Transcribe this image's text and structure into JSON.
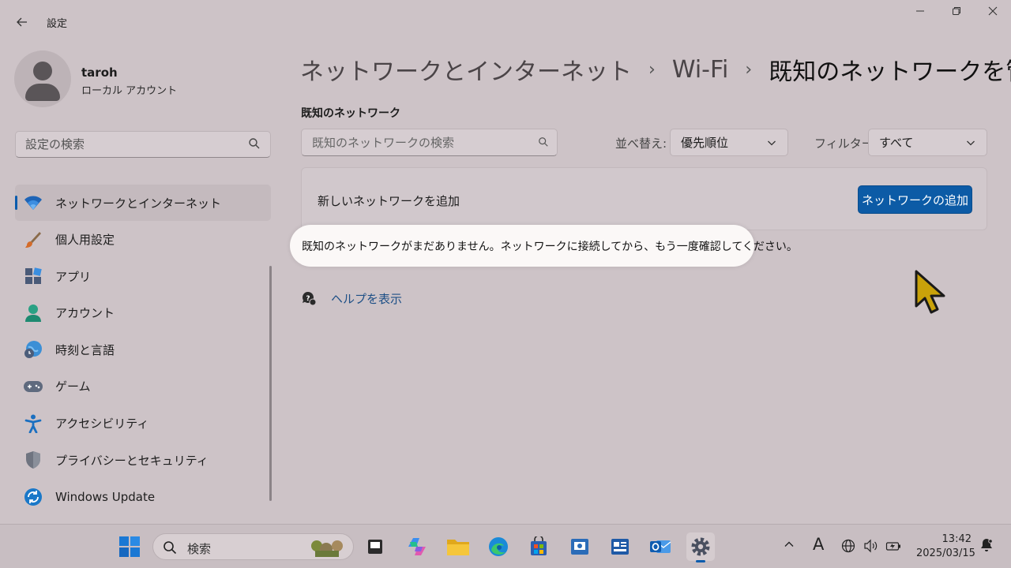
{
  "app": {
    "title": "設定"
  },
  "profile": {
    "name": "taroh",
    "account_type": "ローカル アカウント"
  },
  "sidebar": {
    "search_placeholder": "設定の検索",
    "items": [
      {
        "label": "ネットワークとインターネット",
        "icon": "wifi-icon",
        "active": true
      },
      {
        "label": "個人用設定",
        "icon": "brush-icon"
      },
      {
        "label": "アプリ",
        "icon": "apps-icon"
      },
      {
        "label": "アカウント",
        "icon": "account-icon"
      },
      {
        "label": "時刻と言語",
        "icon": "globe-clock-icon"
      },
      {
        "label": "ゲーム",
        "icon": "gamepad-icon"
      },
      {
        "label": "アクセシビリティ",
        "icon": "accessibility-icon"
      },
      {
        "label": "プライバシーとセキュリティ",
        "icon": "shield-icon"
      },
      {
        "label": "Windows Update",
        "icon": "update-icon"
      }
    ]
  },
  "breadcrumb": {
    "items": [
      "ネットワークとインターネット",
      "Wi-Fi",
      "既知のネットワークを管理"
    ]
  },
  "main": {
    "section_title": "既知のネットワーク",
    "search_placeholder": "既知のネットワークの検索",
    "sort_label": "並べ替え:",
    "sort_value": "優先順位",
    "filter_label": "フィルター:",
    "filter_value": "すべて",
    "add_card_label": "新しいネットワークを追加",
    "add_button": "ネットワークの追加",
    "empty_message": "既知のネットワークがまだありません。ネットワークに接続してから、もう一度確認してください。",
    "help_link": "ヘルプを表示"
  },
  "taskbar": {
    "search_label": "検索",
    "clock_time": "13:42",
    "clock_date": "2025/03/15",
    "ime_indicator": "A"
  },
  "colors": {
    "accent": "#0c5ba6",
    "link": "#1d4f86",
    "highlight_bg": "#fbf8f7"
  }
}
